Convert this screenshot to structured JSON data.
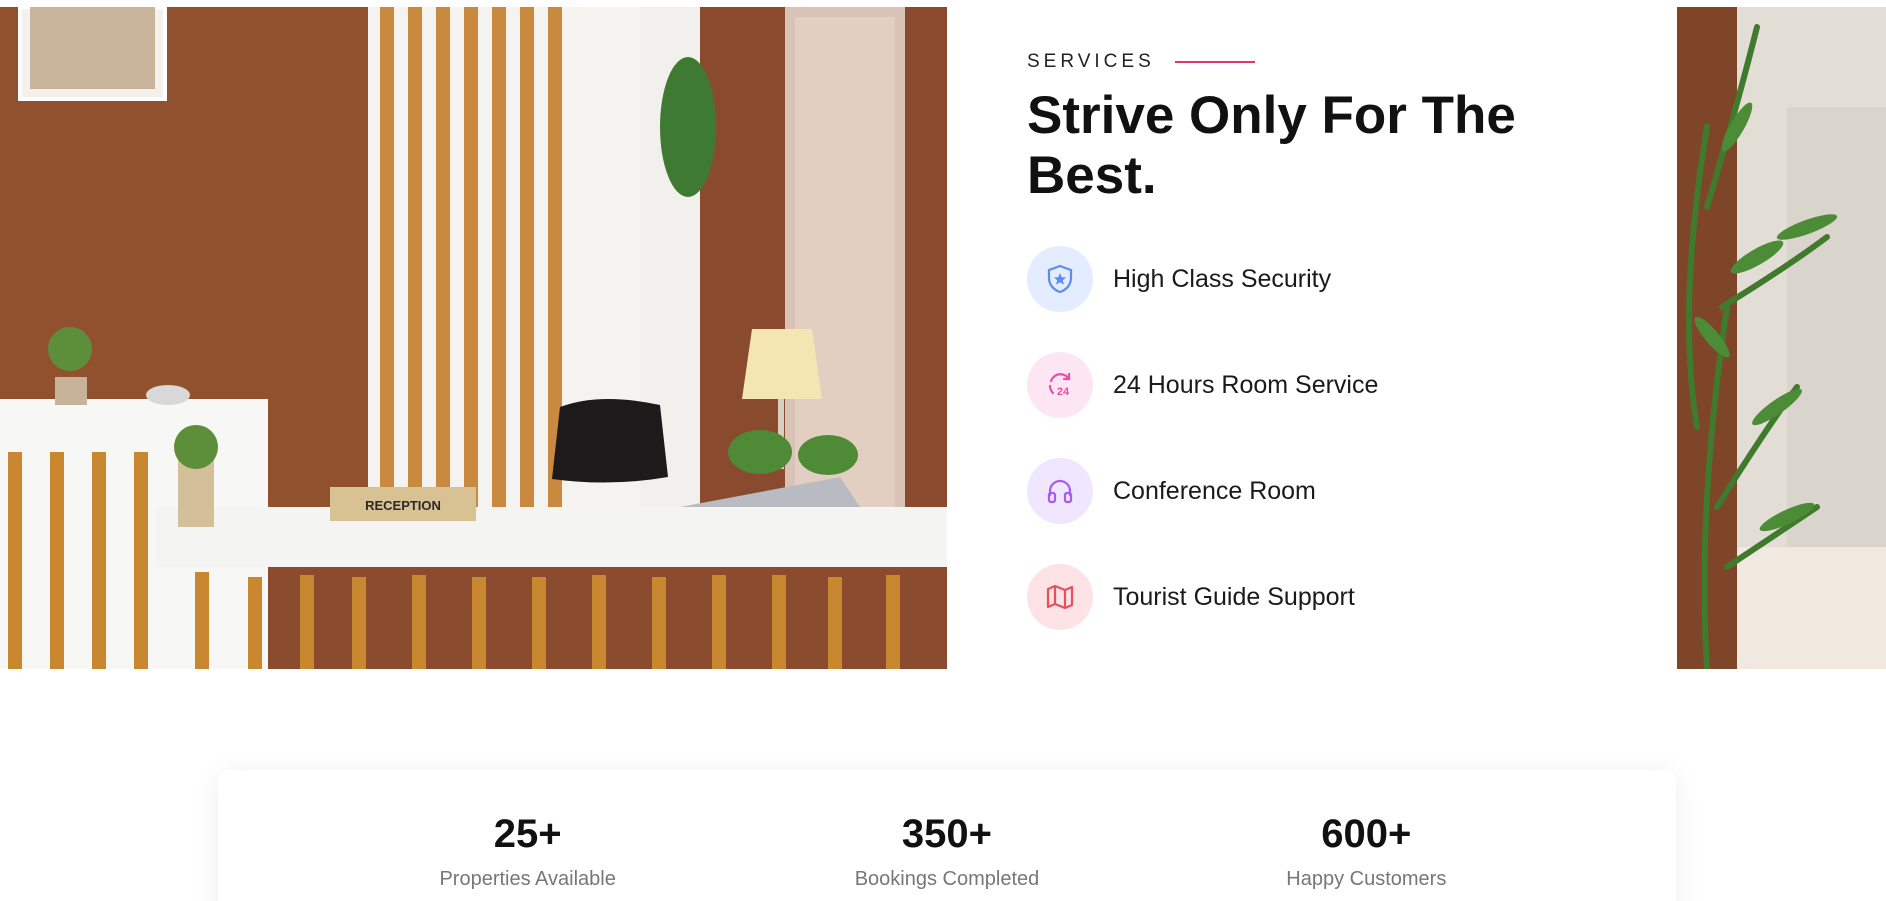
{
  "services": {
    "eyebrow": "SERVICES",
    "headline": "Strive Only For The Best.",
    "features": [
      {
        "label": "High Class Security",
        "icon": "shield-star-icon",
        "color": "#5b8def",
        "bg": "#e3edff"
      },
      {
        "label": "24 Hours Room Service",
        "icon": "24-hours-icon",
        "color": "#e84fa4",
        "bg": "#fde6f3"
      },
      {
        "label": "Conference Room",
        "icon": "headphones-icon",
        "color": "#a55df0",
        "bg": "#f1e6ff"
      },
      {
        "label": "Tourist Guide Support",
        "icon": "map-icon",
        "color": "#e8505b",
        "bg": "#fde3e5"
      }
    ]
  },
  "hero_image": {
    "sign_text": "RECEPTION"
  },
  "stats": [
    {
      "value": "25+",
      "label": "Properties Available"
    },
    {
      "value": "350+",
      "label": "Bookings Completed"
    },
    {
      "value": "600+",
      "label": "Happy Customers"
    }
  ],
  "colors": {
    "accent": "#e6336f"
  }
}
